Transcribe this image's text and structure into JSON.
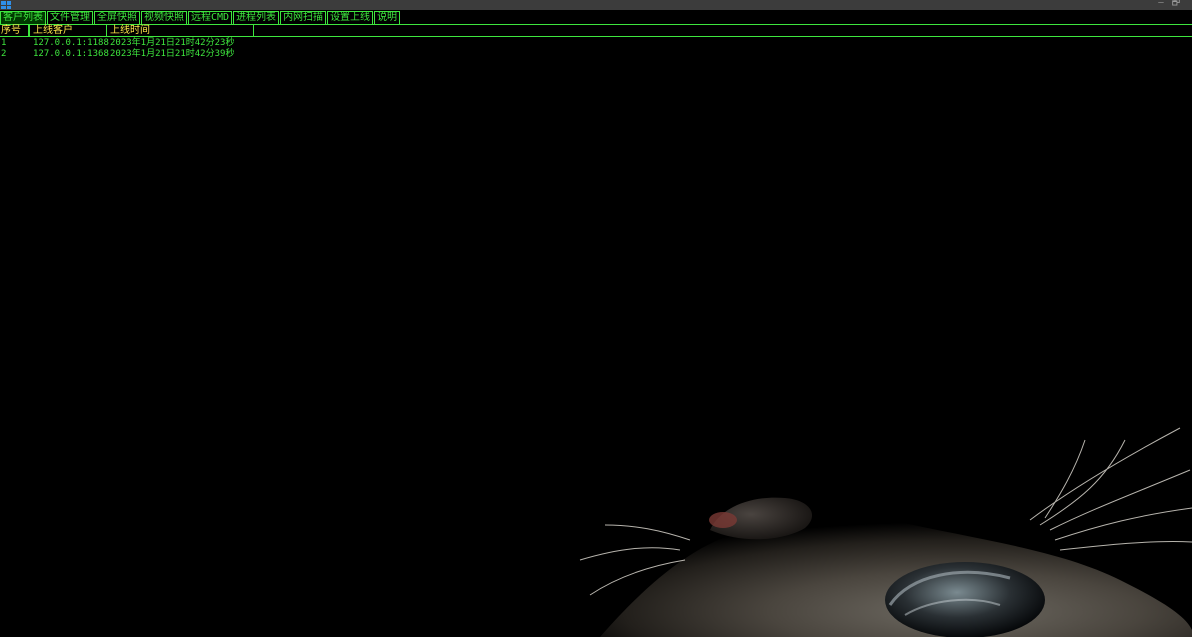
{
  "tabs": [
    {
      "label": "客户列表",
      "active": true
    },
    {
      "label": "文件管理",
      "active": false
    },
    {
      "label": "全屏快照",
      "active": false
    },
    {
      "label": "视频快照",
      "active": false
    },
    {
      "label": "远程CMD",
      "active": false
    },
    {
      "label": "进程列表",
      "active": false
    },
    {
      "label": "内网扫描",
      "active": false
    },
    {
      "label": "设置上线",
      "active": false
    },
    {
      "label": "说明",
      "active": false
    }
  ],
  "window_controls": {
    "minimize": "—",
    "restore": "🗗"
  },
  "list": {
    "columns": [
      "序号",
      "上线客户",
      "上线时间"
    ],
    "rows": [
      {
        "index": "1",
        "client": "127.0.0.1:1188",
        "time": "2023年1月21日21时42分23秒"
      },
      {
        "index": "2",
        "client": "127.0.0.1:1368",
        "time": "2023年1月21日21时42分39秒"
      }
    ]
  },
  "colors": {
    "accent_green": "#3ee63e",
    "header_yellow": "#ffe64a",
    "background": "#000000",
    "titlebar": "#3c3c3c"
  }
}
